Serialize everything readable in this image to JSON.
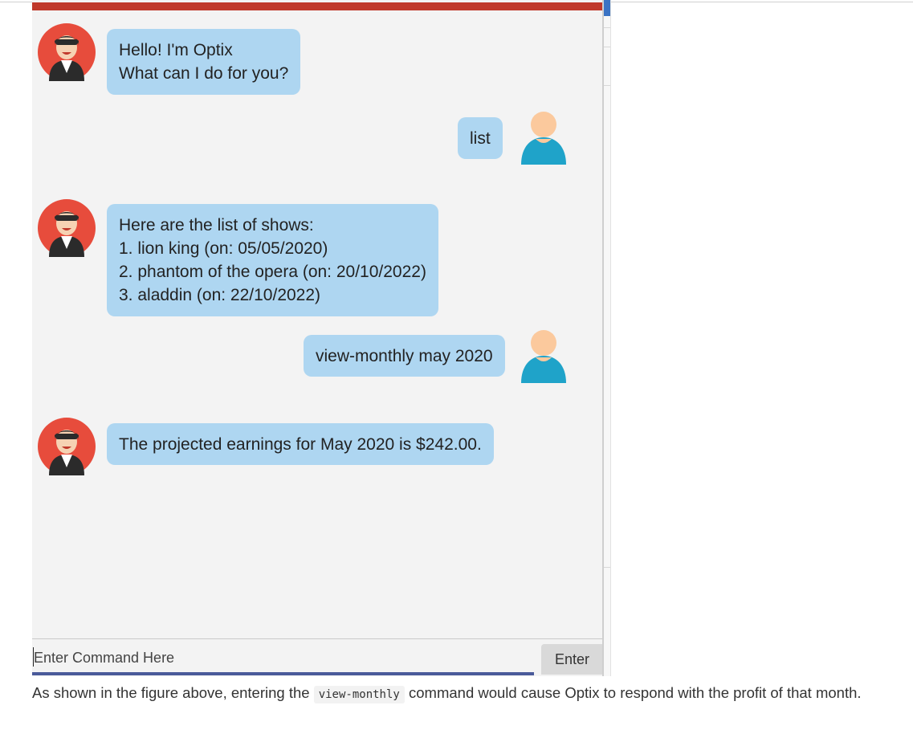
{
  "chat": {
    "messages": [
      {
        "sender": "bot",
        "lines": [
          "Hello! I'm Optix",
          "What can I do for you?"
        ]
      },
      {
        "sender": "user",
        "lines": [
          "list"
        ]
      },
      {
        "sender": "bot",
        "lines": [
          "Here are the list of shows:",
          "1. lion king (on: 05/05/2020)",
          "2. phantom of the opera (on: 20/10/2022)",
          "3. aladdin (on: 22/10/2022)"
        ]
      },
      {
        "sender": "user",
        "lines": [
          "view-monthly may 2020"
        ]
      },
      {
        "sender": "bot",
        "lines": [
          "The projected earnings for May 2020 is $242.00."
        ]
      }
    ]
  },
  "input": {
    "placeholder": "Enter Command Here",
    "value": "",
    "enter_label": "Enter"
  },
  "caption": {
    "before": "As shown in the figure above, entering the",
    "code": "view-monthly",
    "after": "command would cause Optix to respond with the profit of that month."
  },
  "colors": {
    "bubble": "#aed6f1",
    "top_bar": "#c0392b",
    "window_bg": "#f3f3f3",
    "user_avatar": "#1fa3c9",
    "bot_avatar": "#e74c3c"
  },
  "icons": {
    "bot": "bot-avatar-icon",
    "user": "user-avatar-icon"
  }
}
